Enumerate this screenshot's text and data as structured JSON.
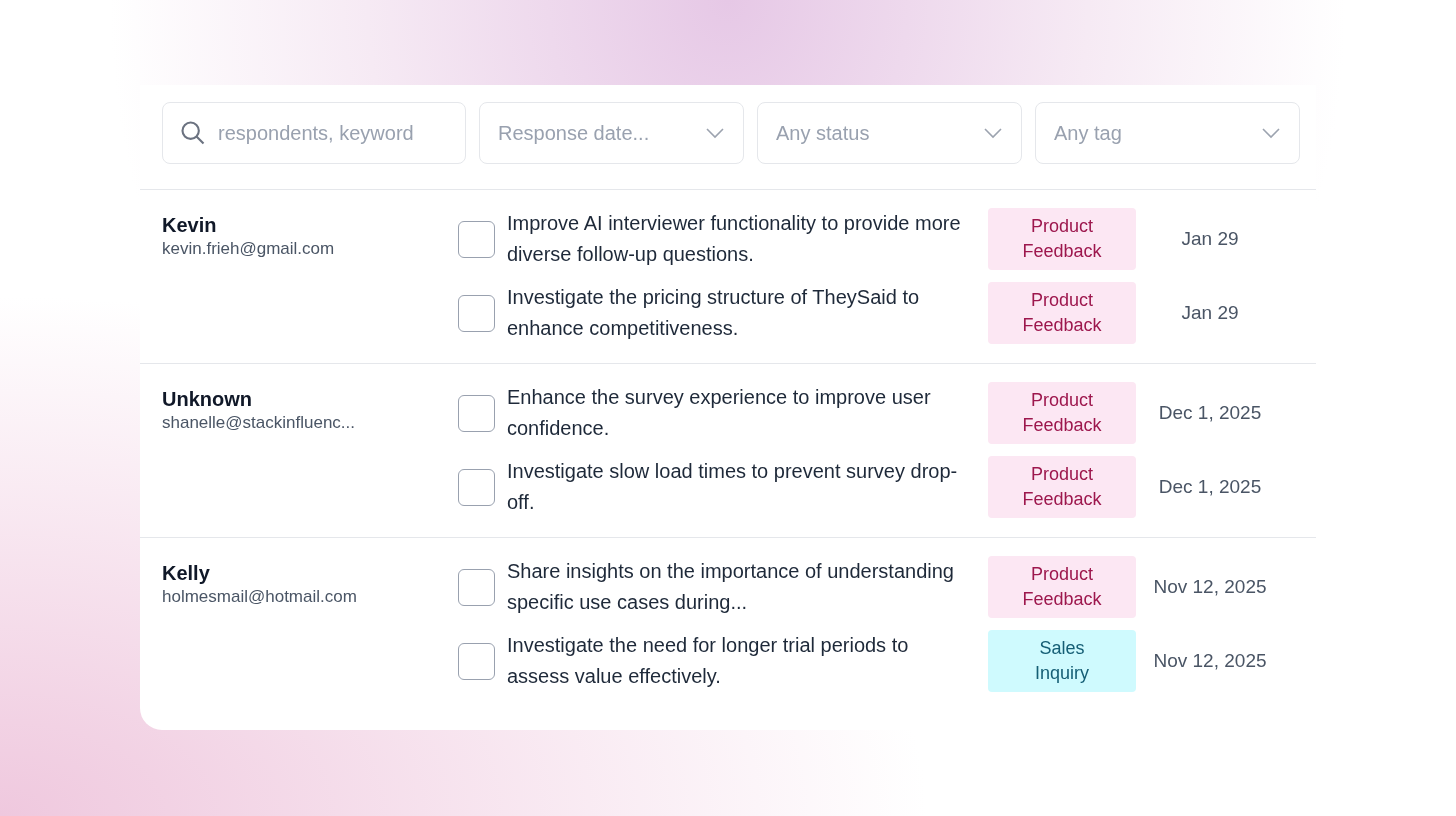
{
  "filters": {
    "search": {
      "placeholder": "respondents, keyword"
    },
    "dropdowns": [
      {
        "placeholder": "Response date..."
      },
      {
        "placeholder": "Any status"
      },
      {
        "placeholder": "Any tag"
      }
    ]
  },
  "groups": [
    {
      "name": "Kevin",
      "email": "kevin.frieh@gmail.com",
      "items": [
        {
          "text": "Improve AI interviewer functionality to provide more diverse follow-up questions.",
          "checked": false,
          "tag": {
            "kind": "product",
            "label": "Product Feedback"
          },
          "date": "Jan 29"
        },
        {
          "text": "Investigate the pricing structure of TheySaid to enhance competitiveness.",
          "checked": false,
          "tag": {
            "kind": "product",
            "label": "Product Feedback"
          },
          "date": "Jan 29"
        }
      ]
    },
    {
      "name": "Unknown",
      "email": "shanelle@stackinfluenc...",
      "items": [
        {
          "text": "Enhance the survey experience to improve user confidence.",
          "checked": false,
          "tag": {
            "kind": "product",
            "label": "Product Feedback"
          },
          "date": "Dec 1, 2025"
        },
        {
          "text": "Investigate slow load times to prevent survey drop-off.",
          "checked": false,
          "tag": {
            "kind": "product",
            "label": "Product Feedback"
          },
          "date": "Dec 1, 2025"
        }
      ]
    },
    {
      "name": "Kelly",
      "email": "holmesmail@hotmail.com",
      "items": [
        {
          "text": "Share insights on the importance of understanding specific use cases during...",
          "checked": false,
          "tag": {
            "kind": "product",
            "label": "Product Feedback"
          },
          "date": "Nov 12, 2025"
        },
        {
          "text": "Investigate the need for longer trial periods to assess value effectively.",
          "checked": false,
          "tag": {
            "kind": "sales",
            "label": "Sales Inquiry"
          },
          "date": "Nov 12, 2025"
        }
      ]
    }
  ]
}
